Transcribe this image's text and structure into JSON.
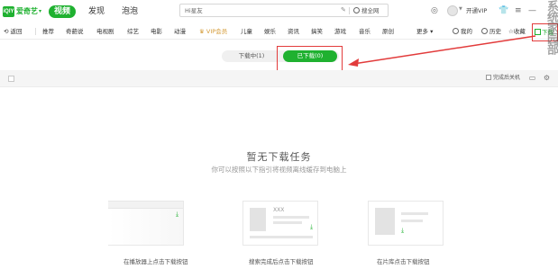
{
  "app": {
    "logo_mark": "iQIY",
    "logo_text": "爱奇艺"
  },
  "top_nav": {
    "tabs": [
      {
        "label": "视频",
        "active": true
      },
      {
        "label": "发现",
        "active": false
      },
      {
        "label": "泡泡",
        "active": false
      }
    ]
  },
  "search": {
    "value": "Hi星友",
    "button_label": "搜全网"
  },
  "user": {
    "vip_link": "开通VIP"
  },
  "channels": {
    "back_label": "返回",
    "items": [
      "推荐",
      "奇葩说",
      "电视剧",
      "综艺",
      "电影",
      "动漫",
      "VIP会员",
      "儿童",
      "娱乐",
      "资讯",
      "搞笑",
      "游戏",
      "音乐",
      "原创",
      "更多"
    ],
    "vip_item": "VIP会员"
  },
  "right_tools": {
    "mine": "我的",
    "history": "历史",
    "favorites": "收藏",
    "download": "下载"
  },
  "download_tabs": [
    {
      "label": "下载中(1)",
      "active": false
    },
    {
      "label": "已下载(0)",
      "active": true
    }
  ],
  "toolbar": {
    "shutdown_label": "完成后关机"
  },
  "empty_state": {
    "title": "暂无下载任务",
    "subtitle": "你可以按照以下指引将视频离线缓存到电脑上"
  },
  "hints": [
    {
      "caption": "在播放器上点击下载按钮"
    },
    {
      "caption": "搜索完成后点击下载按钮",
      "card_text": "XXX"
    },
    {
      "caption": "在片库点击下载按钮"
    }
  ],
  "watermark": "系统家园部",
  "colors": {
    "brand_green": "#1fb130",
    "vip_gold": "#d49a36",
    "annotation_red": "#e23b3b"
  }
}
